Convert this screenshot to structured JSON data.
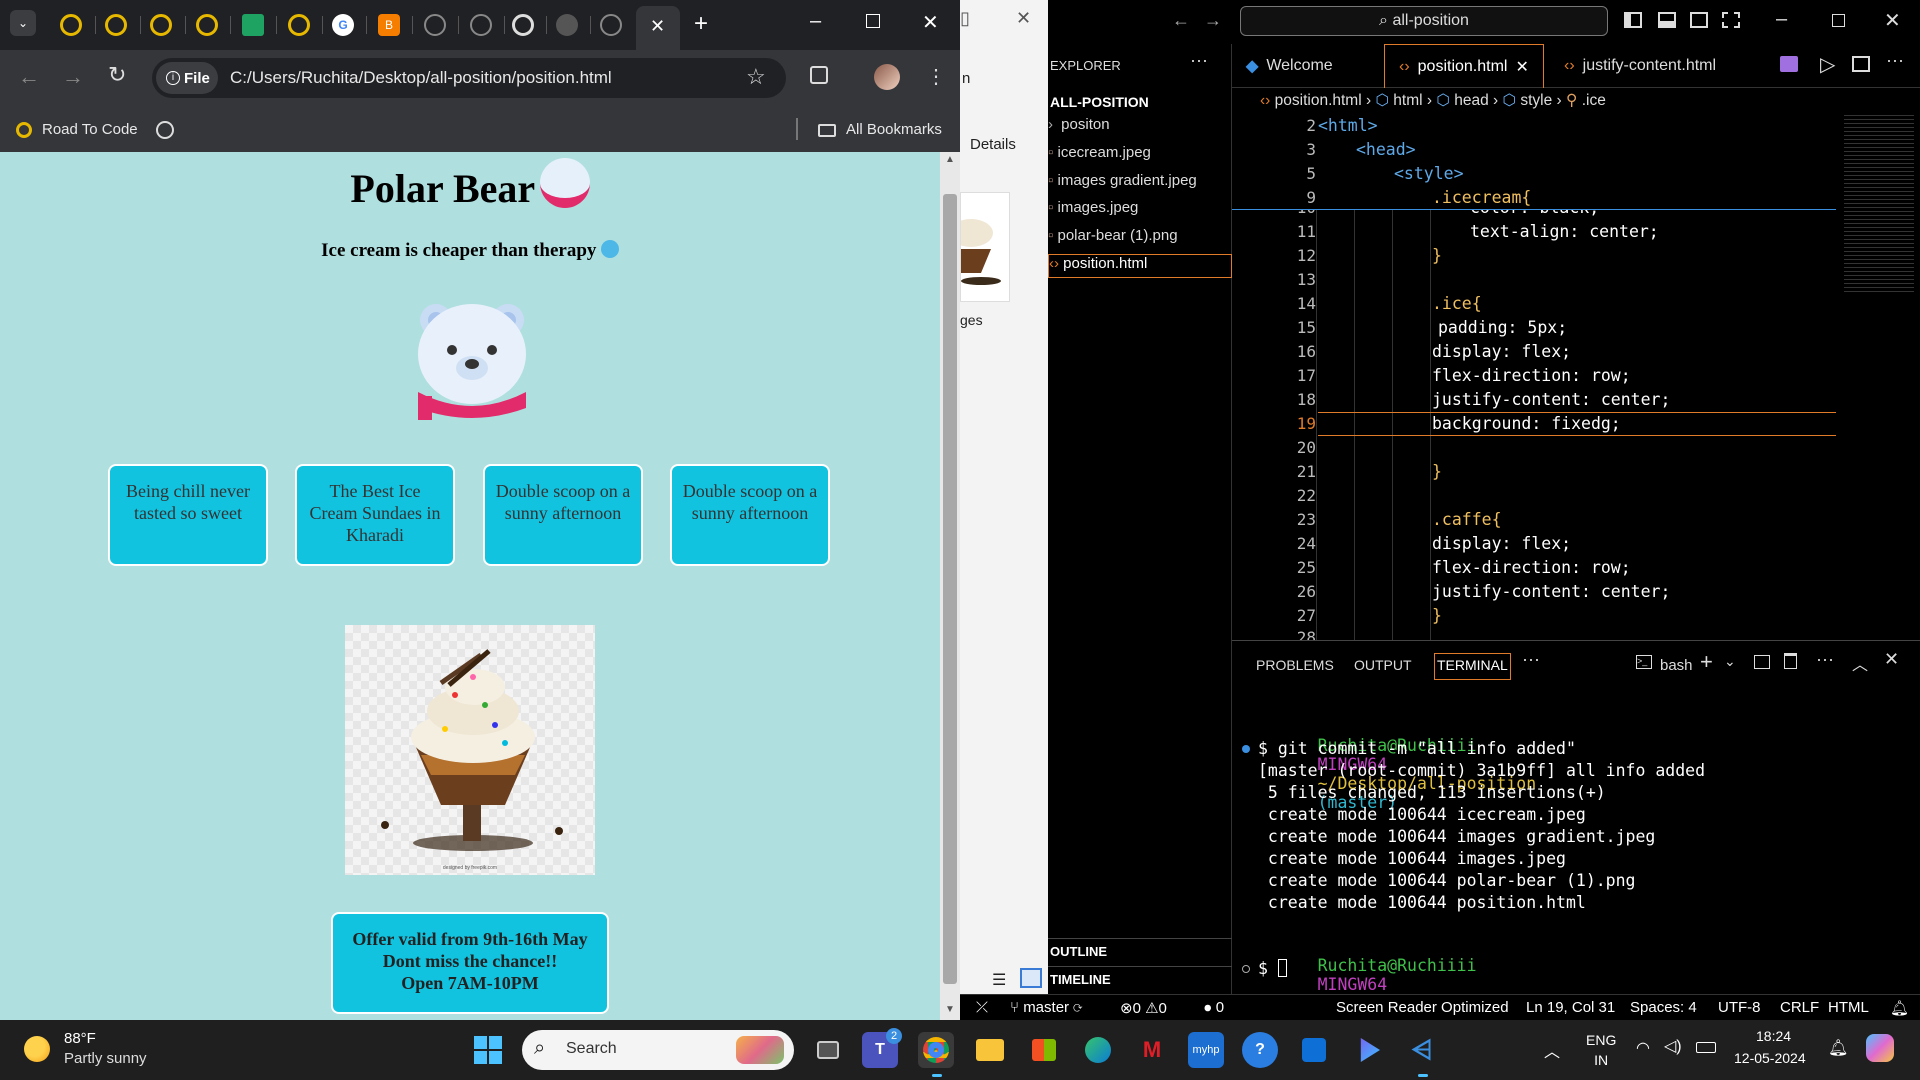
{
  "chrome": {
    "url": "C:/Users/Ruchita/Desktop/all-position/position.html",
    "file_chip": "File",
    "bookmark_1": "Road To Code",
    "all_bookmarks": "All Bookmarks"
  },
  "page": {
    "title": "Polar Bear",
    "subtitle": "Ice cream is cheaper than therapy",
    "cards": [
      "Being chill never tasted so sweet",
      "The Best Ice Cream Sundaes in Kharadi",
      "Double scoop on a sunny afternoon",
      "Double scoop on a sunny afternoon"
    ],
    "image_caption": "designed by freepik.com",
    "offer_line1": "Offer valid from 9th-16th May",
    "offer_line2": "Dont miss the chance!!",
    "offer_line3": "Open 7AM-10PM"
  },
  "explorer_window": {
    "partial_title": "n",
    "details": "Details",
    "partial_label": "ges"
  },
  "vscode": {
    "search": "all-position",
    "explorer_title": "EXPLORER",
    "folder": "ALL-POSITION",
    "files": [
      "positon",
      "icecream.jpeg",
      "images gradient.jpeg",
      "images.jpeg",
      "polar-bear (1).png",
      "position.html"
    ],
    "outline": "OUTLINE",
    "timeline": "TIMELINE",
    "tabs": [
      "Welcome",
      "position.html",
      "justify-content.html"
    ],
    "breadcrumb": [
      "position.html",
      "html",
      "head",
      "style",
      ".ice"
    ],
    "sticky": [
      {
        "n": "2",
        "t": "<html>"
      },
      {
        "n": "3",
        "t": "<head>"
      },
      {
        "n": "5",
        "t": "<style>"
      },
      {
        "n": "9",
        "t": ".icecream{"
      }
    ],
    "lines": [
      {
        "n": "10",
        "t": "color: black;"
      },
      {
        "n": "11",
        "t": "text-align: center;"
      },
      {
        "n": "12",
        "t": "}"
      },
      {
        "n": "13",
        "t": ""
      },
      {
        "n": "14",
        "t": ".ice{"
      },
      {
        "n": "15",
        "t": "padding: 5px;"
      },
      {
        "n": "16",
        "t": "display: flex;"
      },
      {
        "n": "17",
        "t": "flex-direction: row;"
      },
      {
        "n": "18",
        "t": "justify-content: center;"
      },
      {
        "n": "19",
        "t": "background: fixedg;"
      },
      {
        "n": "20",
        "t": ""
      },
      {
        "n": "21",
        "t": "}"
      },
      {
        "n": "22",
        "t": ""
      },
      {
        "n": "23",
        "t": ".caffe{"
      },
      {
        "n": "24",
        "t": "display: flex;"
      },
      {
        "n": "25",
        "t": "flex-direction: row;"
      },
      {
        "n": "26",
        "t": "justify-content: center;"
      },
      {
        "n": "27",
        "t": "}"
      },
      {
        "n": "28",
        "t": ""
      }
    ],
    "panel_tabs": [
      "PROBLEMS",
      "OUTPUT",
      "TERMINAL"
    ],
    "shell": "bash",
    "terminal": {
      "prompt_user": "Ruchita@Ruchiiii",
      "prompt_env": "MINGW64",
      "prompt_path": "~/Desktop/all-position",
      "prompt_branch": "(master)",
      "command": "$ git commit -m \"all info added\"",
      "output": [
        "[master (root-commit) 3a1b9ff] all info added",
        " 5 files changed, 113 insertions(+)",
        " create mode 100644 icecream.jpeg",
        " create mode 100644 images gradient.jpeg",
        " create mode 100644 images.jpeg",
        " create mode 100644 polar-bear (1).png",
        " create mode 100644 position.html"
      ],
      "last_prompt": "$"
    },
    "status": {
      "branch": "master",
      "errors": "0",
      "warnings": "0",
      "ports": "0",
      "screen_reader": "Screen Reader Optimized",
      "position": "Ln 19, Col 31",
      "spaces": "Spaces: 4",
      "encoding": "UTF-8",
      "eol": "CRLF",
      "language": "HTML"
    }
  },
  "taskbar": {
    "temp": "88°F",
    "weather": "Partly sunny",
    "search": "Search",
    "lang1": "ENG",
    "lang2": "IN",
    "time": "18:24",
    "date": "12-05-2024",
    "teams_badge": "2"
  }
}
